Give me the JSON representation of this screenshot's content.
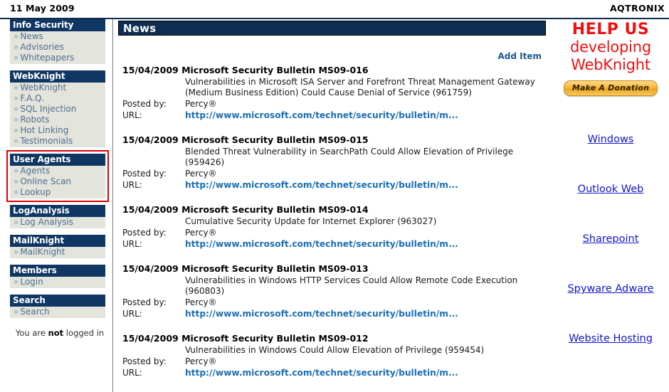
{
  "topbar": {
    "date": "11 May 2009",
    "brand": "AQTRONIX"
  },
  "sidebar": {
    "blocks": [
      {
        "title": "Info Security",
        "highlighted": false,
        "links": [
          {
            "label": "News"
          },
          {
            "label": "Advisories"
          },
          {
            "label": "Whitepapers"
          }
        ]
      },
      {
        "title": "WebKnight",
        "highlighted": false,
        "links": [
          {
            "label": "WebKnight"
          },
          {
            "label": "F.A.Q."
          },
          {
            "label": "SQL Injection"
          },
          {
            "label": "Robots"
          },
          {
            "label": "Hot Linking"
          },
          {
            "label": "Testimonials"
          }
        ]
      },
      {
        "title": "User Agents",
        "highlighted": true,
        "links": [
          {
            "label": "Agents"
          },
          {
            "label": "Online Scan"
          },
          {
            "label": "Lookup"
          }
        ]
      },
      {
        "title": "LogAnalysis",
        "highlighted": false,
        "links": [
          {
            "label": "Log Analysis"
          }
        ]
      },
      {
        "title": "MailKnight",
        "highlighted": false,
        "links": [
          {
            "label": "MailKnight"
          }
        ]
      },
      {
        "title": "Members",
        "highlighted": false,
        "links": [
          {
            "label": "Login"
          }
        ]
      },
      {
        "title": "Search",
        "highlighted": false,
        "links": [
          {
            "label": "Search"
          }
        ]
      }
    ],
    "login_state_prefix": "You are ",
    "login_state_emphasis": "not",
    "login_state_suffix": " logged in",
    "bullet": "»"
  },
  "main": {
    "section_title": "News",
    "add_item_label": "Add Item",
    "posted_by_label": "Posted by:",
    "url_label": "URL:",
    "items": [
      {
        "date": "15/04/2009",
        "title": "Microsoft Security Bulletin MS09-016",
        "description": "Vulnerabilities in Microsoft ISA Server and Forefront Threat Management Gateway (Medium Business Edition) Could Cause Denial of Service (961759)",
        "posted_by": "Percy®",
        "url": "http://www.microsoft.com/technet/security/bulletin/m..."
      },
      {
        "date": "15/04/2009",
        "title": "Microsoft Security Bulletin MS09-015",
        "description": "Blended Threat Vulnerability in SearchPath Could Allow Elevation of Privilege (959426)",
        "posted_by": "Percy®",
        "url": "http://www.microsoft.com/technet/security/bulletin/m..."
      },
      {
        "date": "15/04/2009",
        "title": "Microsoft Security Bulletin MS09-014",
        "description": "Cumulative Security Update for Internet Explorer (963027)",
        "posted_by": "Percy®",
        "url": "http://www.microsoft.com/technet/security/bulletin/m..."
      },
      {
        "date": "15/04/2009",
        "title": "Microsoft Security Bulletin MS09-013",
        "description": "Vulnerabilities in Windows HTTP Services Could Allow Remote Code Execution (960803)",
        "posted_by": "Percy®",
        "url": "http://www.microsoft.com/technet/security/bulletin/m..."
      },
      {
        "date": "15/04/2009",
        "title": "Microsoft Security Bulletin MS09-012",
        "description": "Vulnerabilities in Windows Could Allow Elevation of Privilege (959454)",
        "posted_by": "Percy®",
        "url": "http://www.microsoft.com/technet/security/bulletin/m..."
      }
    ]
  },
  "promo": {
    "line1": "HELP US",
    "line2": "developing",
    "line3": "WebKnight",
    "donate_label": "Make A Donation"
  },
  "ads": {
    "links": [
      {
        "label": "Windows"
      },
      {
        "label": "Outlook Web"
      },
      {
        "label": "Sharepoint"
      },
      {
        "label": "Spyware Adware"
      },
      {
        "label": "Website Hosting"
      }
    ]
  },
  "colors": {
    "nav_header_bg": "#103763",
    "nav_link_bg": "#e3e4dc",
    "nav_link_text": "#4d6e8f",
    "section_header_bg": "#0d2d52",
    "promo_red": "#ee1111",
    "url_blue": "#1a6fb5",
    "ad_link_blue": "#1414cc",
    "highlight_red": "#e00000"
  }
}
